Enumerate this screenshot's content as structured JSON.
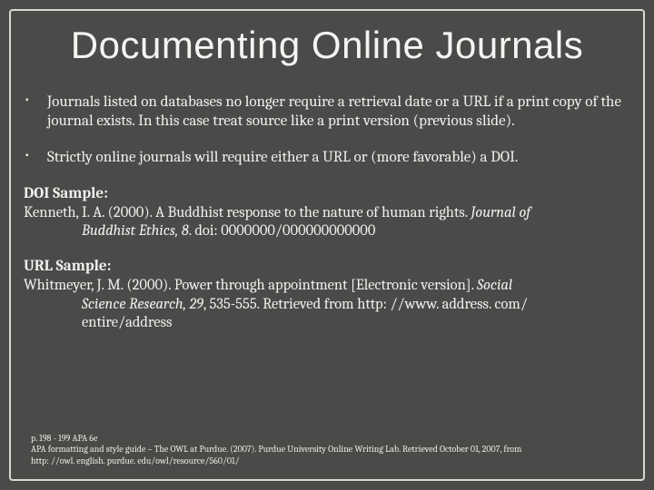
{
  "title": "Documenting Online Journals",
  "bullets": [
    "Journals listed on databases no longer require a retrieval date or a URL if a print copy of the journal exists. In this case treat source like a print version (previous slide).",
    "Strictly online journals will  require either a URL or (more favorable) a DOI."
  ],
  "doi": {
    "heading": "DOI Sample:",
    "line1": "Kenneth, I. A. (2000). A Buddhist response to the nature of human rights. ",
    "ital1": "Journal of",
    "hang_ital": "Buddhist Ethics, 8",
    "hang_rest": ". doi: 0000000/000000000000"
  },
  "url": {
    "heading": "URL Sample:",
    "line1": "Whitmeyer, J. M. (2000). Power through appointment [Electronic version]. ",
    "ital1": "Social",
    "hang_ital": "Science Research, 29",
    "hang_rest": ", 535-555. Retrieved from http: //www. address. com/",
    "hang2": "entire/address"
  },
  "footer": {
    "l1": "p. 198 - 199 APA 6e",
    "l2": "APA formatting and style guide – The OWL at Purdue. (2007). Purdue University Online Writing Lab. Retrieved October 01, 2007, from",
    "l3": "http: //owl. english. purdue. edu/owl/resource/560/01/"
  }
}
